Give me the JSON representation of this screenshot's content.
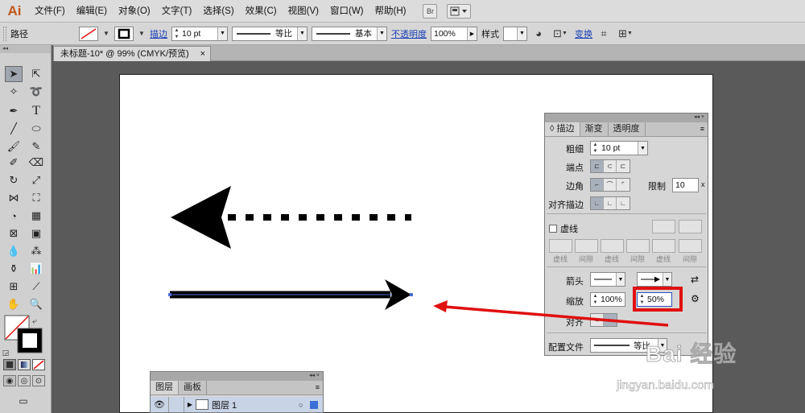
{
  "app": {
    "logo": "Ai"
  },
  "menu": [
    "文件(F)",
    "编辑(E)",
    "对象(O)",
    "文字(T)",
    "选择(S)",
    "效果(C)",
    "视图(V)",
    "窗口(W)",
    "帮助(H)"
  ],
  "menubar_buttons": [
    "Br"
  ],
  "controlbar": {
    "object_type": "路径",
    "stroke_label": "描边",
    "stroke_weight": "10 pt",
    "profile_label": "等比",
    "brush_label": "基本",
    "opacity_label": "不透明度",
    "opacity_value": "100%",
    "style_label": "样式",
    "transform_label": "变换"
  },
  "document_tab": {
    "title": "未标题-10* @ 99% (CMYK/预览)",
    "close": "×"
  },
  "stroke_panel": {
    "tabs": [
      "描边",
      "渐变",
      "透明度"
    ],
    "weight_label": "粗细",
    "weight_value": "10 pt",
    "cap_label": "端点",
    "corner_label": "边角",
    "limit_label": "限制",
    "limit_value": "10",
    "limit_unit": "x",
    "align_label": "对齐描边",
    "dashed_label": "虚线",
    "dash_labels": [
      "虚线",
      "间隙",
      "虚线",
      "间隙",
      "虚线",
      "间隙"
    ],
    "arrowheads_label": "箭头",
    "scale_label": "缩放",
    "scale_start": "100%",
    "scale_end": "50%",
    "arrow_align_label": "对齐",
    "profile_label": "配置文件",
    "profile_value": "等比"
  },
  "layers_panel": {
    "tabs": [
      "图层",
      "画板"
    ],
    "layer_name": "图层 1"
  },
  "watermark": {
    "brand": "Bai 经验",
    "url": "jingyan.baidu.com"
  },
  "colors": {
    "highlight": "#e01010",
    "arrow_red": "#e01010",
    "link_blue": "#1a3fb5"
  }
}
